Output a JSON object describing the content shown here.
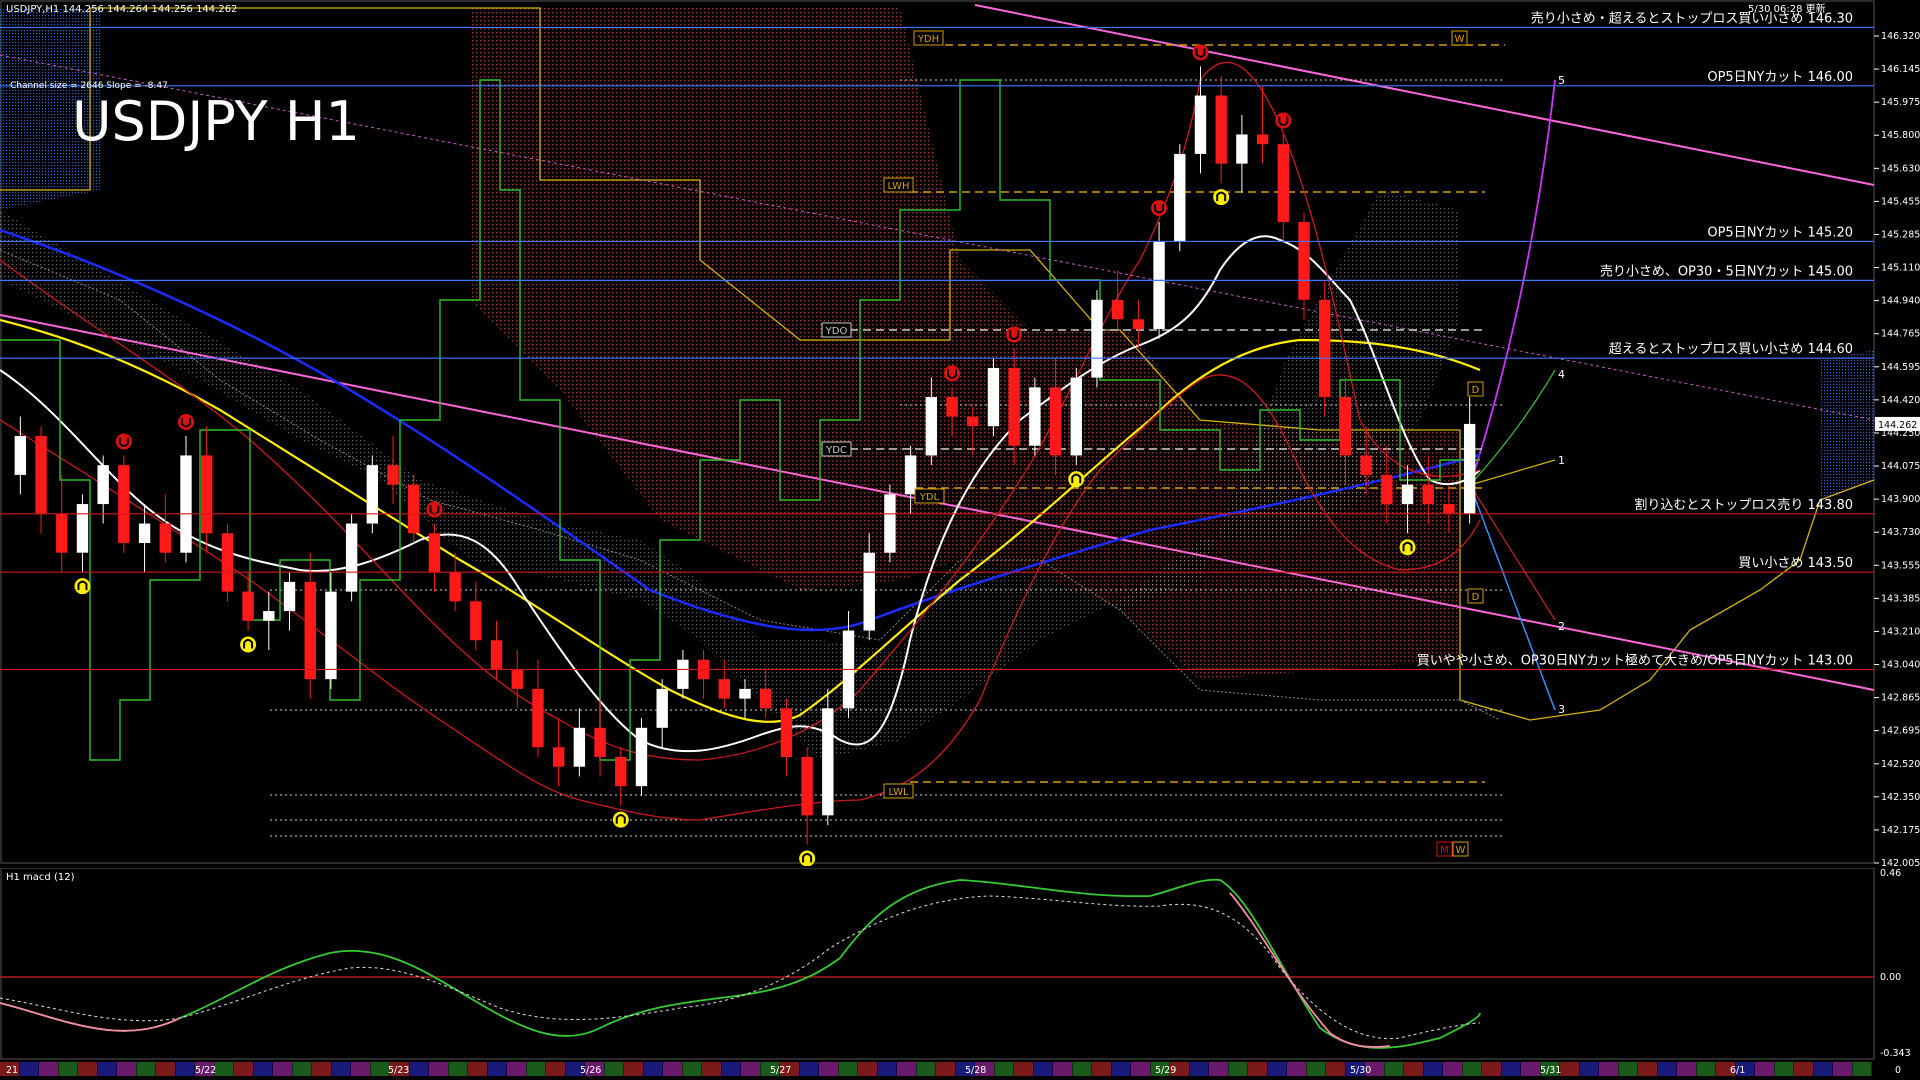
{
  "header": {
    "symbol_line": "USDJPY,H1  144.256 144.264 144.256 144.262",
    "timestamp": "5/30 06:28 更新",
    "channel_info": "Channel size = 2646 Slope = -8.47",
    "big_title": "USDJPY H1"
  },
  "macd_pane": {
    "label": "H1  macd (12)",
    "axis": {
      "top": "0.46",
      "zero": "0.00",
      "bottom": "-0.343"
    },
    "zero_line_color": "#cc2222",
    "main_color": "#33cc33",
    "main_down_color": "#ff88aa",
    "signal_color": "#dddddd"
  },
  "price_axis": {
    "ticks": [
      "146.320",
      "146.145",
      "145.975",
      "145.800",
      "145.630",
      "145.455",
      "145.285",
      "145.110",
      "144.940",
      "144.765",
      "144.595",
      "144.420",
      "144.250",
      "144.075",
      "143.900",
      "143.730",
      "143.555",
      "143.385",
      "143.210",
      "143.040",
      "142.865",
      "142.695",
      "142.520",
      "142.350",
      "142.175",
      "142.005"
    ],
    "current_price": "144.262"
  },
  "ref_boxes": {
    "ydh": "YDH",
    "lwh": "LWH",
    "ydo": "YDO",
    "ydc": "YDC",
    "ydl": "YDL",
    "lwl": "LWL",
    "w_top": "W",
    "d_top": "D",
    "d_bottom": "D",
    "m_bottom": "M",
    "w_bottom": "W"
  },
  "levels": [
    {
      "price": 146.3,
      "label": "売り小さめ・超えるとストップロス買い小さめ 146.30",
      "color": "#3a78ff"
    },
    {
      "price": 146.0,
      "label": "OP5日NYカット 146.00",
      "color": "#3a78ff"
    },
    {
      "price": 145.2,
      "label": "OP5日NYカット 145.20",
      "color": "#3a78ff"
    },
    {
      "price": 145.0,
      "label": "売り小さめ、OP30・5日NYカット 145.00",
      "color": "#3a78ff"
    },
    {
      "price": 144.6,
      "label": "超えるとストップロス買い小さめ 144.60",
      "color": "#3a78ff"
    },
    {
      "price": 143.8,
      "label": "割り込むとストップロス売り 143.80",
      "color": "#d01818"
    },
    {
      "price": 143.5,
      "label": "買い小さめ 143.50",
      "color": "#d01818"
    },
    {
      "price": 143.0,
      "label": "買いやや小さめ、OP30日NYカット極めて大きめ/OP5日NYカット 143.00",
      "color": "#d01818"
    }
  ],
  "wave_labels": [
    "5",
    "4",
    "1",
    "2",
    "3"
  ],
  "date_labels": [
    "21",
    "5/22",
    "5/23",
    "5/26",
    "5/27",
    "5/28",
    "5/29",
    "5/30",
    "5/31",
    "6/1",
    "0"
  ],
  "chart_data": {
    "type": "candlestick",
    "title": "USDJPY H1",
    "ylim": [
      142.005,
      146.4
    ],
    "candles": [
      [
        144.0,
        144.3,
        143.9,
        144.2
      ],
      [
        144.2,
        144.25,
        143.7,
        143.8
      ],
      [
        143.8,
        144.0,
        143.5,
        143.6
      ],
      [
        143.6,
        143.9,
        143.5,
        143.85
      ],
      [
        143.85,
        144.1,
        143.75,
        144.05
      ],
      [
        144.05,
        144.1,
        143.6,
        143.65
      ],
      [
        143.65,
        143.85,
        143.5,
        143.75
      ],
      [
        143.75,
        143.9,
        143.55,
        143.6
      ],
      [
        143.6,
        144.2,
        143.55,
        144.1
      ],
      [
        144.1,
        144.25,
        143.6,
        143.7
      ],
      [
        143.7,
        143.75,
        143.35,
        143.4
      ],
      [
        143.4,
        143.5,
        143.2,
        143.25
      ],
      [
        143.25,
        143.4,
        143.1,
        143.3
      ],
      [
        143.3,
        143.5,
        143.2,
        143.45
      ],
      [
        143.45,
        143.6,
        142.85,
        142.95
      ],
      [
        142.95,
        143.5,
        142.9,
        143.4
      ],
      [
        143.4,
        143.8,
        143.35,
        143.75
      ],
      [
        143.75,
        144.1,
        143.7,
        144.05
      ],
      [
        144.05,
        144.2,
        143.85,
        143.95
      ],
      [
        143.95,
        144.0,
        143.65,
        143.7
      ],
      [
        143.7,
        143.75,
        143.4,
        143.5
      ],
      [
        143.5,
        143.6,
        143.3,
        143.35
      ],
      [
        143.35,
        143.45,
        143.1,
        143.15
      ],
      [
        143.15,
        143.25,
        142.95,
        143.0
      ],
      [
        143.0,
        143.1,
        142.8,
        142.9
      ],
      [
        142.9,
        143.05,
        142.55,
        142.6
      ],
      [
        142.6,
        142.75,
        142.4,
        142.5
      ],
      [
        142.5,
        142.8,
        142.45,
        142.7
      ],
      [
        142.7,
        142.85,
        142.45,
        142.55
      ],
      [
        142.55,
        142.6,
        142.3,
        142.4
      ],
      [
        142.4,
        142.75,
        142.35,
        142.7
      ],
      [
        142.7,
        142.95,
        142.6,
        142.9
      ],
      [
        142.9,
        143.1,
        142.85,
        143.05
      ],
      [
        143.05,
        143.1,
        142.85,
        142.95
      ],
      [
        142.95,
        143.05,
        142.8,
        142.85
      ],
      [
        142.85,
        142.95,
        142.75,
        142.9
      ],
      [
        142.9,
        143.0,
        142.75,
        142.8
      ],
      [
        142.8,
        142.85,
        142.45,
        142.55
      ],
      [
        142.55,
        142.6,
        142.1,
        142.25
      ],
      [
        142.25,
        142.9,
        142.2,
        142.8
      ],
      [
        142.8,
        143.3,
        142.75,
        143.2
      ],
      [
        143.2,
        143.7,
        143.15,
        143.6
      ],
      [
        143.6,
        143.95,
        143.55,
        143.9
      ],
      [
        143.9,
        144.15,
        143.8,
        144.1
      ],
      [
        144.1,
        144.5,
        144.05,
        144.4
      ],
      [
        144.4,
        144.45,
        144.2,
        144.3
      ],
      [
        144.3,
        144.35,
        144.1,
        144.25
      ],
      [
        144.25,
        144.6,
        144.2,
        144.55
      ],
      [
        144.55,
        144.65,
        144.05,
        144.15
      ],
      [
        144.15,
        144.5,
        144.1,
        144.45
      ],
      [
        144.45,
        144.6,
        144.0,
        144.1
      ],
      [
        144.1,
        144.55,
        144.05,
        144.5
      ],
      [
        144.5,
        144.95,
        144.45,
        144.9
      ],
      [
        144.9,
        145.05,
        144.75,
        144.8
      ],
      [
        144.8,
        144.9,
        144.65,
        144.75
      ],
      [
        144.75,
        145.3,
        144.7,
        145.2
      ],
      [
        145.2,
        145.7,
        145.15,
        145.65
      ],
      [
        145.65,
        146.1,
        145.55,
        145.95
      ],
      [
        145.95,
        146.05,
        145.5,
        145.6
      ],
      [
        145.6,
        145.85,
        145.45,
        145.75
      ],
      [
        145.75,
        146.0,
        145.6,
        145.7
      ],
      [
        145.7,
        145.75,
        145.2,
        145.3
      ],
      [
        145.3,
        145.35,
        144.8,
        144.9
      ],
      [
        144.9,
        145.0,
        144.3,
        144.4
      ],
      [
        144.4,
        144.5,
        143.95,
        144.1
      ],
      [
        144.1,
        144.25,
        143.9,
        144.0
      ],
      [
        144.0,
        144.15,
        143.75,
        143.85
      ],
      [
        143.85,
        144.05,
        143.7,
        143.95
      ],
      [
        143.95,
        144.1,
        143.75,
        143.85
      ],
      [
        143.85,
        143.95,
        143.7,
        143.8
      ],
      [
        143.8,
        144.4,
        143.75,
        144.262
      ]
    ],
    "series": [
      {
        "name": "",
        "color": "#ffffff"
      },
      {
        "name": "",
        "color": "#ffee00"
      },
      {
        "name": "",
        "color": "#1a2cff"
      }
    ]
  }
}
